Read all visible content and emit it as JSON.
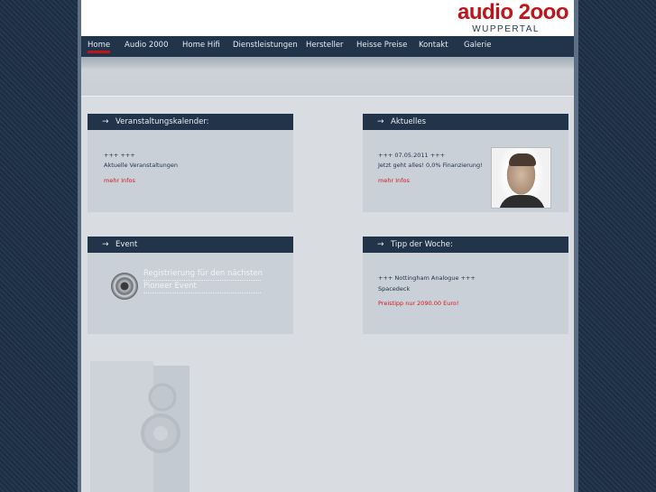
{
  "logo": {
    "name": "audio 2ooo",
    "city": "WUPPERTAL"
  },
  "nav": {
    "items": [
      {
        "label": "Home",
        "active": true
      },
      {
        "label": "Audio 2000"
      },
      {
        "label": "Home Hifi"
      },
      {
        "label": "Dienstleistungen"
      },
      {
        "label": "Hersteller"
      },
      {
        "label": "Heisse Preise"
      },
      {
        "label": "Kontakt"
      },
      {
        "label": "Galerie"
      }
    ]
  },
  "panels": {
    "kalender": {
      "title": "Veranstaltungskalender:",
      "line1": "+++ +++",
      "line2": "Aktuelle Veranstaltungen",
      "link": "mehr Infos"
    },
    "aktuelles": {
      "title": "Aktuelles",
      "line1": "+++ 07.05.2011 +++",
      "line2": "Jetzt geht alles! 0,0% Finanzierung!",
      "link": "mehr Infos"
    },
    "event": {
      "title": "Event",
      "link_line1": "Registrierung für den nächsten",
      "link_line2": "Pioneer Event"
    },
    "tipp": {
      "title": "Tipp der Woche:",
      "line1": "+++ Nottingham Analogue +++",
      "line2": "Spacedeck",
      "price": "Preistipp nur 2090.00 Euro!"
    }
  },
  "icons": {
    "arrow": "→",
    "event": "speaker-disc-icon",
    "background": "speaker-icon"
  },
  "colors": {
    "brand_red": "#c0141b",
    "navy": "#22344a",
    "panel": "#c9d0d8"
  }
}
